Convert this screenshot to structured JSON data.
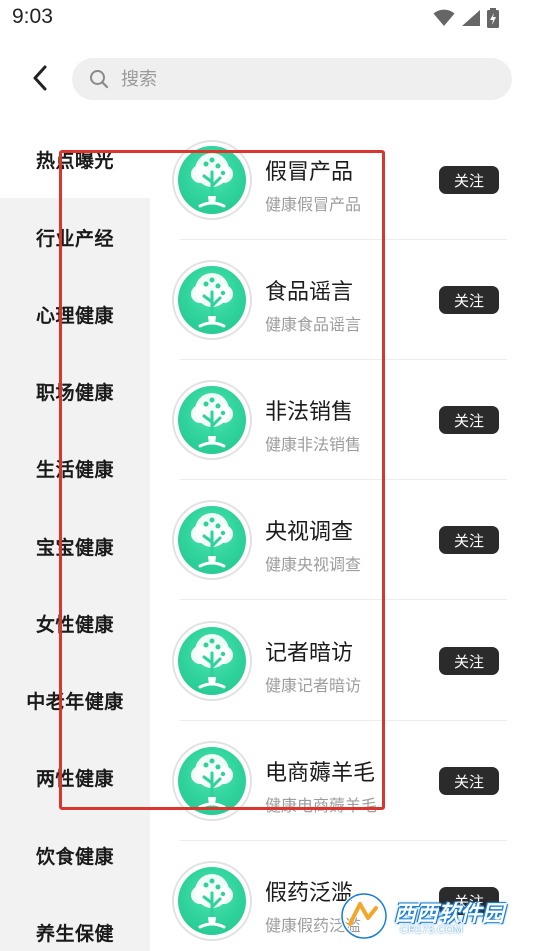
{
  "status_bar": {
    "time": "9:03"
  },
  "header": {
    "search_placeholder": "搜索"
  },
  "sidebar": {
    "items": [
      {
        "label": "热点曝光",
        "active": true
      },
      {
        "label": "行业产经"
      },
      {
        "label": "心理健康"
      },
      {
        "label": "职场健康"
      },
      {
        "label": "生活健康"
      },
      {
        "label": "宝宝健康"
      },
      {
        "label": "女性健康"
      },
      {
        "label": "中老年健康"
      },
      {
        "label": "两性健康"
      },
      {
        "label": "饮食健康"
      },
      {
        "label": "养生保健"
      }
    ]
  },
  "list": {
    "items": [
      {
        "title": "假冒产品",
        "subtitle": "健康假冒产品",
        "button": "关注"
      },
      {
        "title": "食品谣言",
        "subtitle": "健康食品谣言",
        "button": "关注"
      },
      {
        "title": "非法销售",
        "subtitle": "健康非法销售",
        "button": "关注"
      },
      {
        "title": "央视调查",
        "subtitle": "健康央视调查",
        "button": "关注"
      },
      {
        "title": "记者暗访",
        "subtitle": "健康记者暗访",
        "button": "关注"
      },
      {
        "title": "电商薅羊毛",
        "subtitle": "健康电商薅羊毛",
        "button": "关注"
      },
      {
        "title": "假药泛滥",
        "subtitle": "健康假药泛滥",
        "button": "关注"
      }
    ]
  },
  "watermark": {
    "text": "西西软件园",
    "sub": "CR173.COM"
  },
  "colors": {
    "accent_green": "#2ed29a",
    "button_bg": "#2b2b2b",
    "highlight_red": "#d9372e",
    "sidebar_bg": "#f2f2f2"
  }
}
